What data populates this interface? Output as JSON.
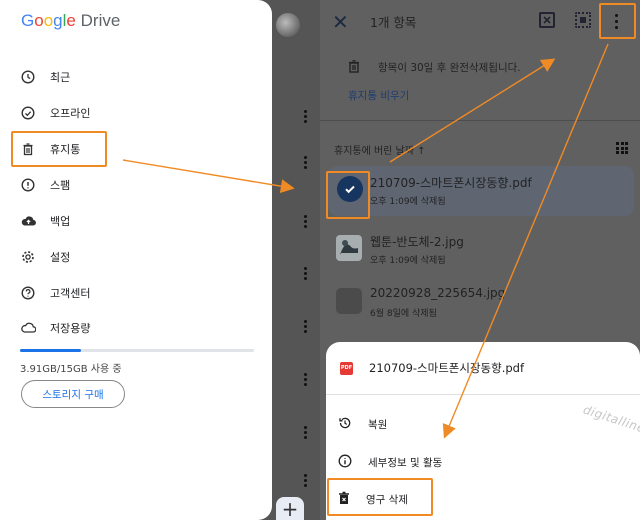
{
  "left": {
    "logo": {
      "google": "Google",
      "drive": "Drive"
    },
    "menu": [
      {
        "icon": "clock-icon",
        "label": "최근"
      },
      {
        "icon": "offline-icon",
        "label": "오프라인"
      },
      {
        "icon": "trash-icon",
        "label": "휴지통"
      },
      {
        "icon": "spam-icon",
        "label": "스팸"
      },
      {
        "icon": "backup-icon",
        "label": "백업"
      },
      {
        "icon": "gear-icon",
        "label": "설정"
      },
      {
        "icon": "help-icon",
        "label": "고객센터"
      },
      {
        "icon": "cloud-icon",
        "label": "저장용량"
      }
    ],
    "storage": {
      "text": "3.91GB/15GB 사용 중",
      "used_fraction": 0.26
    },
    "buy_button": "스토리지 구매",
    "fab": "+"
  },
  "right": {
    "title": "1개 항목",
    "notice": "항목이 30일 후 완전삭제됩니다.",
    "empty_trash": "휴지통 비우기",
    "sort_label": "휴지통에 버린 날짜",
    "sort_arrow": "↑",
    "files": [
      {
        "name": "210709-스마트폰시장동향.pdf",
        "sub": "오후 1:09에 삭제됨",
        "selected": true
      },
      {
        "name": "웹툰-반도체-2.jpg",
        "sub": "오후 1:09에 삭제됨",
        "selected": false
      },
      {
        "name": "20220928_225654.jpg",
        "sub": "6월 8일에 삭제됨",
        "selected": false
      }
    ],
    "sheet": {
      "file_name": "210709-스마트폰시장동향.pdf",
      "pdf_icon_text": "PDF",
      "actions": [
        {
          "icon": "restore-icon",
          "label": "복원"
        },
        {
          "icon": "info-icon",
          "label": "세부정보 및 활동"
        },
        {
          "icon": "delete-forever-icon",
          "label": "영구 삭제"
        }
      ]
    },
    "watermark": "digitalline"
  },
  "colors": {
    "annotation": "#f08a24",
    "accent": "#1a73e8"
  }
}
